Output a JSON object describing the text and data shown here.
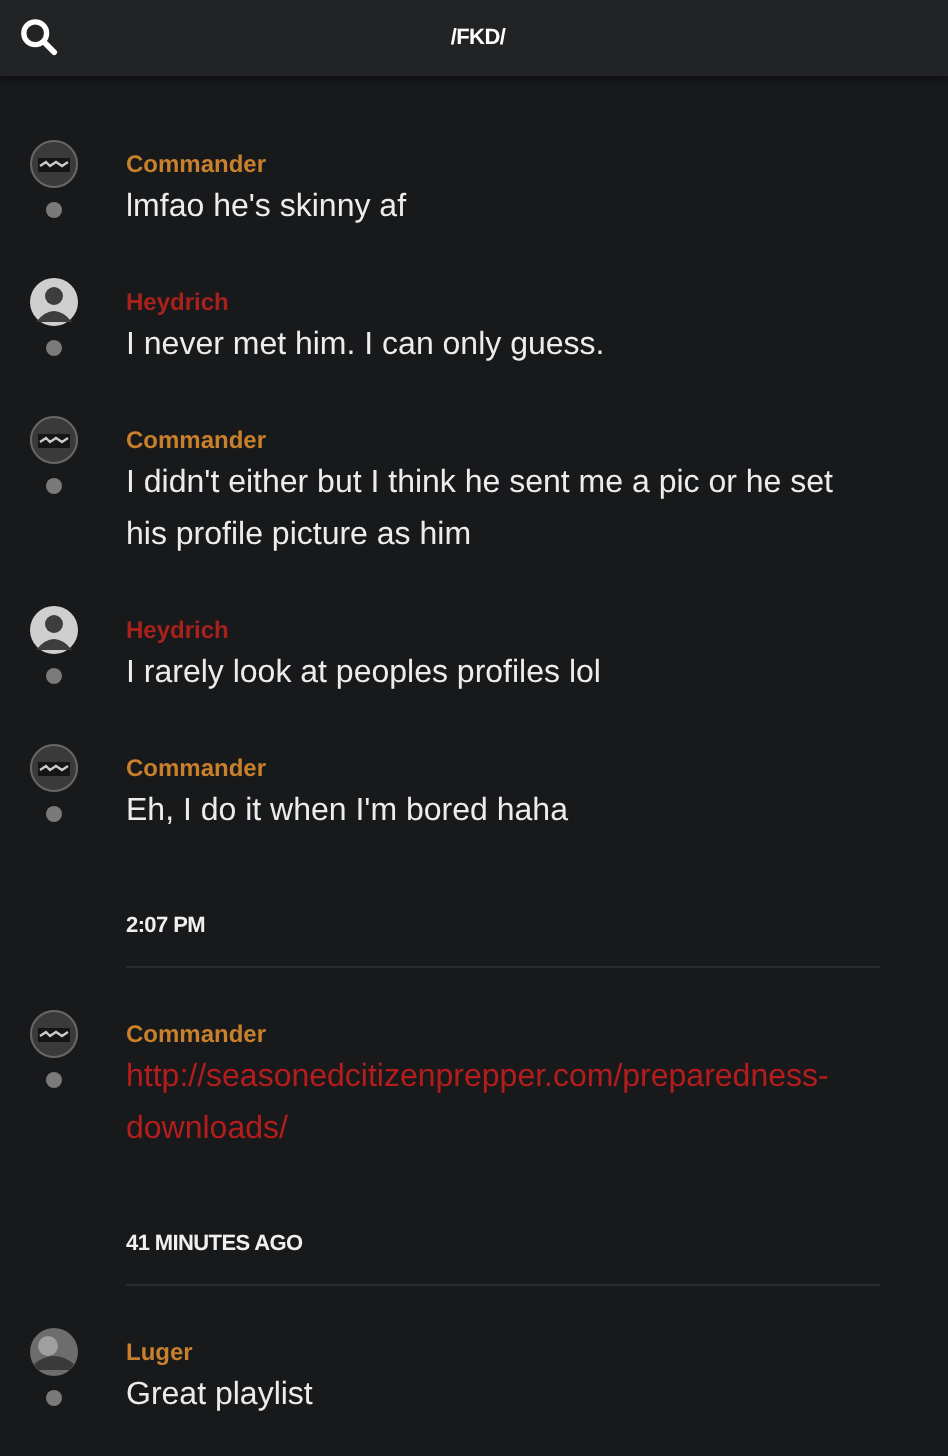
{
  "header": {
    "title": "/FKD/"
  },
  "feed": [
    {
      "kind": "message",
      "avatar": {
        "kind": "pattern"
      },
      "author": "Commander",
      "color": "#c8802c",
      "text": "lmfao he's skinny af"
    },
    {
      "kind": "message",
      "avatar": {
        "kind": "figure"
      },
      "author": "Heydrich",
      "color": "#a9211c",
      "text": "I never met him. I can only guess."
    },
    {
      "kind": "message",
      "avatar": {
        "kind": "pattern"
      },
      "author": "Commander",
      "color": "#c8802c",
      "text": "I didn't either but I think he sent me a pic or he set his profile picture as him"
    },
    {
      "kind": "message",
      "avatar": {
        "kind": "figure"
      },
      "author": "Heydrich",
      "color": "#a9211c",
      "text": "I rarely look at peoples profiles lol"
    },
    {
      "kind": "message",
      "avatar": {
        "kind": "pattern"
      },
      "author": "Commander",
      "color": "#c8802c",
      "text": "Eh, I do it when I'm bored haha"
    },
    {
      "kind": "separator",
      "text": "2:07 PM"
    },
    {
      "kind": "link",
      "avatar": {
        "kind": "pattern"
      },
      "author": "Commander",
      "color": "#c8802c",
      "text": "http://seasonedcitizenprepper.com/preparedness-downloads/"
    },
    {
      "kind": "separator",
      "text": "41 MINUTES AGO"
    },
    {
      "kind": "message",
      "avatar": {
        "kind": "photo"
      },
      "author": "Luger",
      "color": "#c8802c",
      "text": "Great playlist"
    }
  ]
}
